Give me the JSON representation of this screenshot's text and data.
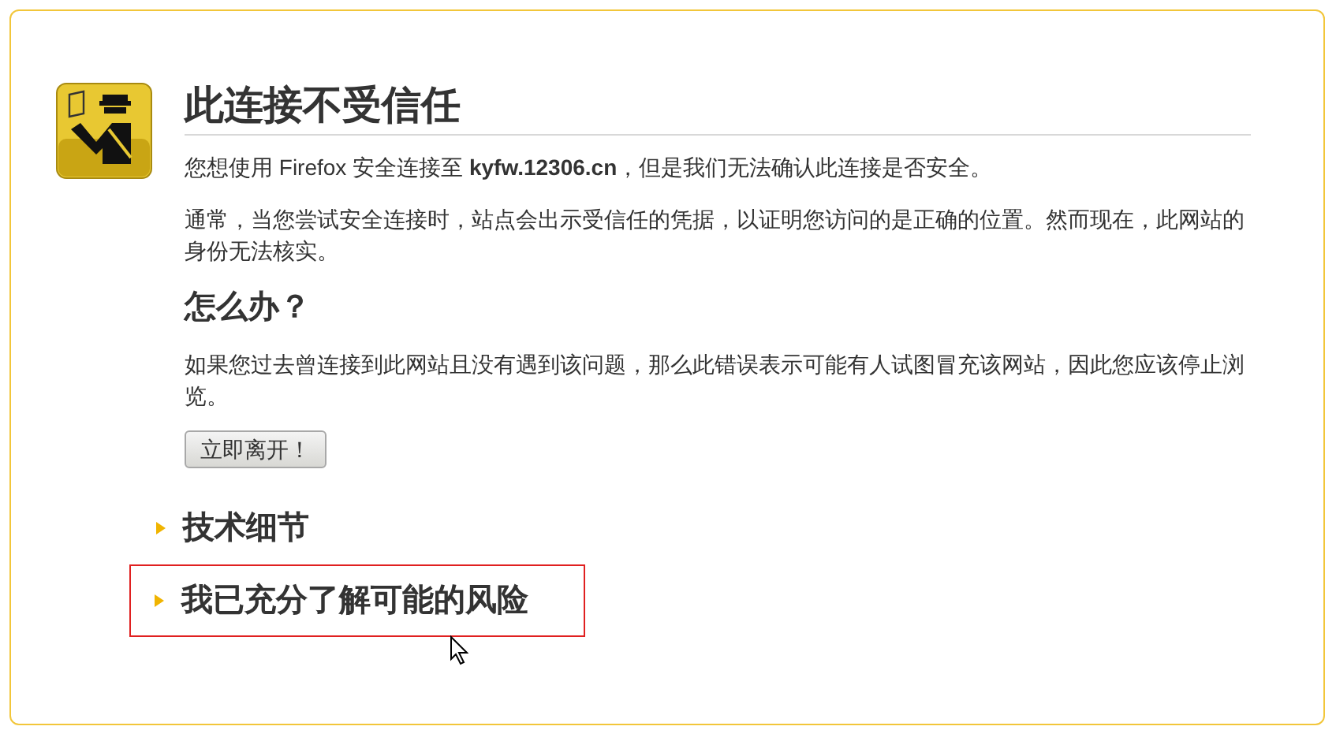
{
  "title": "此连接不受信任",
  "intro": "您想使用 Firefox 安全连接至 **kyfw.12306.cn**，但是我们无法确认此连接是否安全。",
  "explanation": "通常，当您尝试安全连接时，站点会出示受信任的凭据，以证明您访问的是正确的位置。然而现在，此网站的身份无法核实。",
  "heading": "怎么办？",
  "advice": "如果您过去曾连接到此网站且没有遇到该问题，那么此错误表示可能有人试图冒充该网站，因此您应该停止浏览。",
  "button": "立即离开！",
  "sections": [
    {
      "label": "技术细节",
      "expanded": false,
      "highlighted": false
    },
    {
      "label": "我已充分了解可能的风险",
      "expanded": false,
      "highlighted": true
    }
  ]
}
